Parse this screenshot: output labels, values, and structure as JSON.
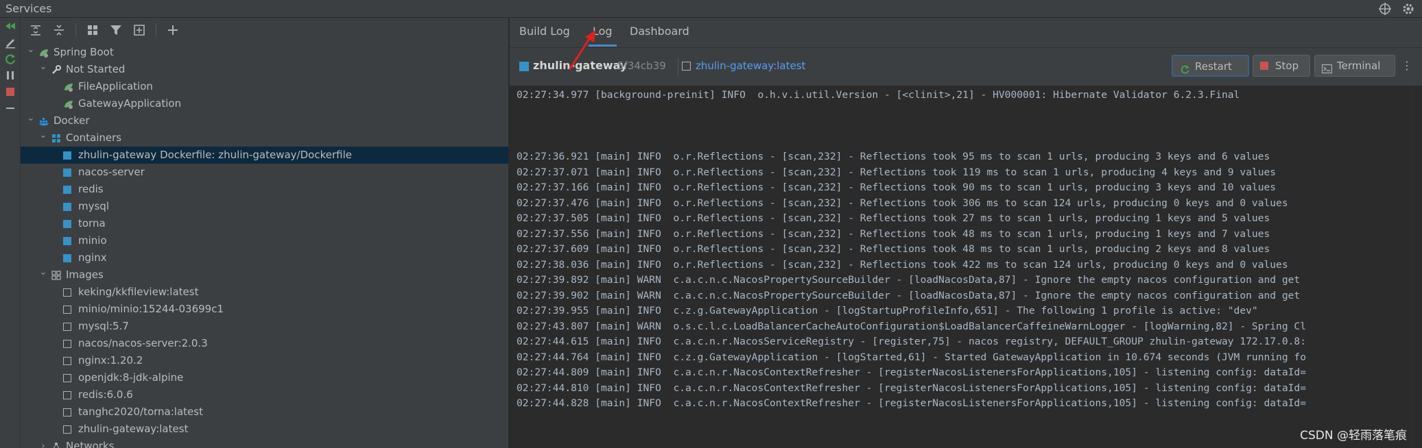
{
  "window": {
    "title": "Services"
  },
  "tree": {
    "rows": [
      {
        "label": "Spring Boot",
        "indent": 0,
        "expanded": true,
        "icon": "spring-boot-icon"
      },
      {
        "label": "Not Started",
        "indent": 1,
        "expanded": true,
        "icon": "wrench-icon"
      },
      {
        "label": "FileApplication",
        "indent": 2,
        "icon": "spring-app-icon"
      },
      {
        "label": "GatewayApplication",
        "indent": 2,
        "icon": "spring-app-icon"
      },
      {
        "label": "Docker",
        "indent": 0,
        "expanded": true,
        "icon": "docker-icon"
      },
      {
        "label": "Containers",
        "indent": 1,
        "expanded": true,
        "icon": "containers-icon"
      },
      {
        "label": "zhulin-gateway Dockerfile: zhulin-gateway/Dockerfile",
        "indent": 2,
        "icon": "container-icon",
        "selected": true
      },
      {
        "label": "nacos-server",
        "indent": 2,
        "icon": "container-icon"
      },
      {
        "label": "redis",
        "indent": 2,
        "icon": "container-icon"
      },
      {
        "label": "mysql",
        "indent": 2,
        "icon": "container-icon"
      },
      {
        "label": "torna",
        "indent": 2,
        "icon": "container-icon"
      },
      {
        "label": "minio",
        "indent": 2,
        "icon": "container-icon"
      },
      {
        "label": "nginx",
        "indent": 2,
        "icon": "container-icon"
      },
      {
        "label": "Images",
        "indent": 1,
        "expanded": true,
        "icon": "images-icon"
      },
      {
        "label": "keking/kkfileview:latest",
        "indent": 2,
        "icon": "image-icon"
      },
      {
        "label": "minio/minio:15244-03699c1",
        "indent": 2,
        "icon": "image-icon"
      },
      {
        "label": "mysql:5.7",
        "indent": 2,
        "icon": "image-icon"
      },
      {
        "label": "nacos/nacos-server:2.0.3",
        "indent": 2,
        "icon": "image-icon"
      },
      {
        "label": "nginx:1.20.2",
        "indent": 2,
        "icon": "image-icon"
      },
      {
        "label": "openjdk:8-jdk-alpine",
        "indent": 2,
        "icon": "image-icon"
      },
      {
        "label": "redis:6.0.6",
        "indent": 2,
        "icon": "image-icon"
      },
      {
        "label": "tanghc2020/torna:latest",
        "indent": 2,
        "icon": "image-icon"
      },
      {
        "label": "zhulin-gateway:latest",
        "indent": 2,
        "icon": "image-icon"
      },
      {
        "label": "Networks",
        "indent": 1,
        "expanded": false,
        "icon": "networks-icon"
      }
    ]
  },
  "tabs": [
    "Build Log",
    "Log",
    "Dashboard"
  ],
  "active_tab": "Log",
  "header": {
    "container_name": "zhulin-gateway",
    "container_id": "5f34cb39",
    "image_link": "zhulin-gateway:latest",
    "buttons": {
      "restart": "Restart",
      "stop": "Stop",
      "terminal": "Terminal"
    }
  },
  "log": [
    "02:27:34.977 [background-preinit] INFO  o.h.v.i.util.Version - [<clinit>,21] - HV000001: Hibernate Validator 6.2.3.Final",
    "",
    "",
    "",
    "02:27:36.921 [main] INFO  o.r.Reflections - [scan,232] - Reflections took 95 ms to scan 1 urls, producing 3 keys and 6 values",
    "02:27:37.071 [main] INFO  o.r.Reflections - [scan,232] - Reflections took 119 ms to scan 1 urls, producing 4 keys and 9 values",
    "02:27:37.166 [main] INFO  o.r.Reflections - [scan,232] - Reflections took 90 ms to scan 1 urls, producing 3 keys and 10 values",
    "02:27:37.476 [main] INFO  o.r.Reflections - [scan,232] - Reflections took 306 ms to scan 124 urls, producing 0 keys and 0 values",
    "02:27:37.505 [main] INFO  o.r.Reflections - [scan,232] - Reflections took 27 ms to scan 1 urls, producing 1 keys and 5 values",
    "02:27:37.556 [main] INFO  o.r.Reflections - [scan,232] - Reflections took 48 ms to scan 1 urls, producing 1 keys and 7 values",
    "02:27:37.609 [main] INFO  o.r.Reflections - [scan,232] - Reflections took 48 ms to scan 1 urls, producing 2 keys and 8 values",
    "02:27:38.036 [main] INFO  o.r.Reflections - [scan,232] - Reflections took 422 ms to scan 124 urls, producing 0 keys and 0 values",
    "02:27:39.892 [main] WARN  c.a.c.n.c.NacosPropertySourceBuilder - [loadNacosData,87] - Ignore the empty nacos configuration and get",
    "02:27:39.902 [main] WARN  c.a.c.n.c.NacosPropertySourceBuilder - [loadNacosData,87] - Ignore the empty nacos configuration and get",
    "02:27:39.955 [main] INFO  c.z.g.GatewayApplication - [logStartupProfileInfo,651] - The following 1 profile is active: \"dev\"",
    "02:27:43.807 [main] WARN  o.s.c.l.c.LoadBalancerCacheAutoConfiguration$LoadBalancerCaffeineWarnLogger - [logWarning,82] - Spring Cl",
    "02:27:44.615 [main] INFO  c.a.c.n.r.NacosServiceRegistry - [register,75] - nacos registry, DEFAULT_GROUP zhulin-gateway 172.17.0.8:",
    "02:27:44.764 [main] INFO  c.z.g.GatewayApplication - [logStarted,61] - Started GatewayApplication in 10.674 seconds (JVM running fo",
    "02:27:44.809 [main] INFO  c.a.c.n.r.NacosContextRefresher - [registerNacosListenersForApplications,105] - listening config: dataId=",
    "02:27:44.810 [main] INFO  c.a.c.n.r.NacosContextRefresher - [registerNacosListenersForApplications,105] - listening config: dataId=",
    "02:27:44.828 [main] INFO  c.a.c.n.r.NacosContextRefresher - [registerNacosListenersForApplications,105] - listening config: dataId="
  ],
  "watermark": "CSDN @轻雨落笔痕",
  "colors": {
    "accent": "#4a88c7",
    "selection": "#0d293e",
    "container": "#3592c4",
    "link": "#589df6",
    "stop": "#c75450",
    "annotation_arrow": "#e02020"
  }
}
